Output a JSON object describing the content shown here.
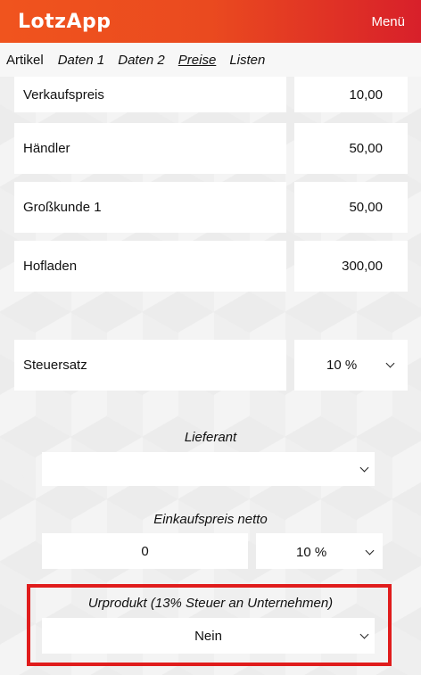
{
  "header": {
    "app_title": "LotzApp",
    "menu_label": "Menü"
  },
  "tabs": [
    {
      "label": "Artikel",
      "active": false
    },
    {
      "label": "Daten 1",
      "active": false
    },
    {
      "label": "Daten 2",
      "active": false
    },
    {
      "label": "Preise",
      "active": true
    },
    {
      "label": "Listen",
      "active": false
    }
  ],
  "prices": [
    {
      "label": "Verkaufspreis",
      "value": "10,00"
    },
    {
      "label": "Händler",
      "value": "50,00"
    },
    {
      "label": "Großkunde 1",
      "value": "50,00"
    },
    {
      "label": "Hofladen",
      "value": "300,00"
    }
  ],
  "tax": {
    "label": "Steuersatz",
    "value": "10 %"
  },
  "supplier": {
    "label": "Lieferant",
    "value": ""
  },
  "purchase": {
    "label": "Einkaufspreis netto",
    "value": "0",
    "tax_value": "10 %"
  },
  "urprodukt": {
    "label": "Urprodukt (13% Steuer an Unternehmen)",
    "value": "Nein"
  },
  "colors": {
    "header_start": "#f0541e",
    "header_end": "#d8202a",
    "highlight": "#e01c1c"
  }
}
